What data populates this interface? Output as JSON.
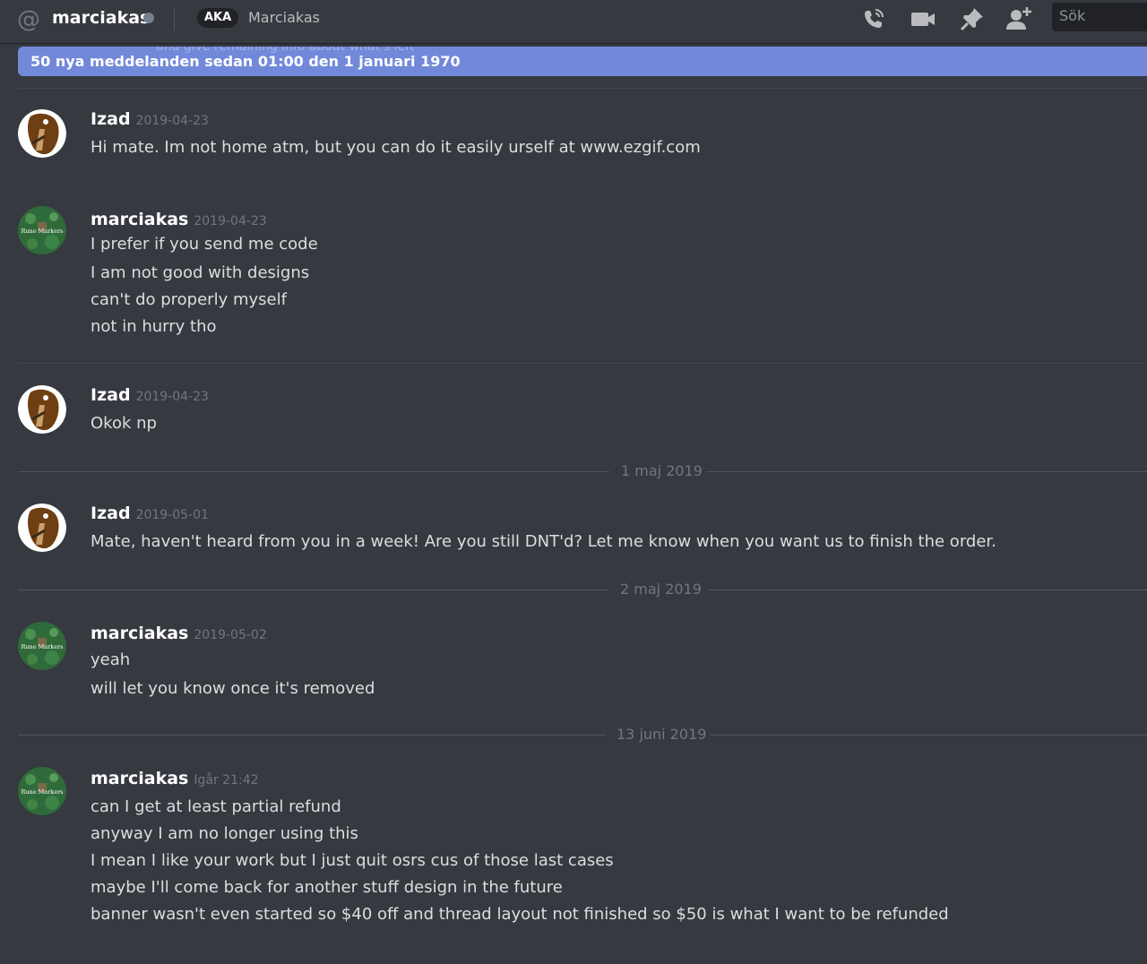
{
  "header": {
    "title": "marciakas",
    "aka_badge": "AKA",
    "nickname": "Marciakas",
    "search_placeholder": "Sök"
  },
  "new_messages_bar": {
    "ghost_text": "and give remaining info about what's left",
    "text": "50 nya meddelanden sedan 01:00 den 1 januari 1970"
  },
  "dates": {
    "d1": "1 maj 2019",
    "d2": "2 maj 2019",
    "d3": "13 juni 2019"
  },
  "messages": [
    {
      "author": "Izad",
      "timestamp": "2019-04-23",
      "lines": [
        "Hi mate. Im not home atm, but you can do it easily urself at www.ezgif.com"
      ]
    },
    {
      "author": "marciakas",
      "timestamp": "2019-04-23",
      "lines": [
        "I prefer if you send me code",
        "I am not good with designs",
        "can't do properly myself",
        "not in hurry tho"
      ]
    },
    {
      "author": "Izad",
      "timestamp": "2019-04-23",
      "lines": [
        "Okok np"
      ]
    },
    {
      "author": "Izad",
      "timestamp": "2019-05-01",
      "lines": [
        "Mate, haven't heard from you in a week! Are you still DNT'd? Let me know when you want us to finish the order."
      ]
    },
    {
      "author": "marciakas",
      "timestamp": "2019-05-02",
      "lines": [
        "yeah",
        "will let you know once it's removed"
      ]
    },
    {
      "author": "marciakas",
      "timestamp": "Igår 21:42",
      "lines": [
        "can I get at least partial refund",
        "anyway I am no longer using this",
        "I mean I like your work but I just quit osrs cus of those last cases",
        "maybe I'll come back for another stuff design in the future",
        "banner wasn't even started so $40 off and thread layout not finished so $50 is what I want to be refunded"
      ]
    }
  ],
  "avatar_text": {
    "marciakas": "Rune Markers"
  },
  "colors": {
    "background": "#36393f",
    "blurple": "#7289da",
    "muted": "#72767d"
  }
}
